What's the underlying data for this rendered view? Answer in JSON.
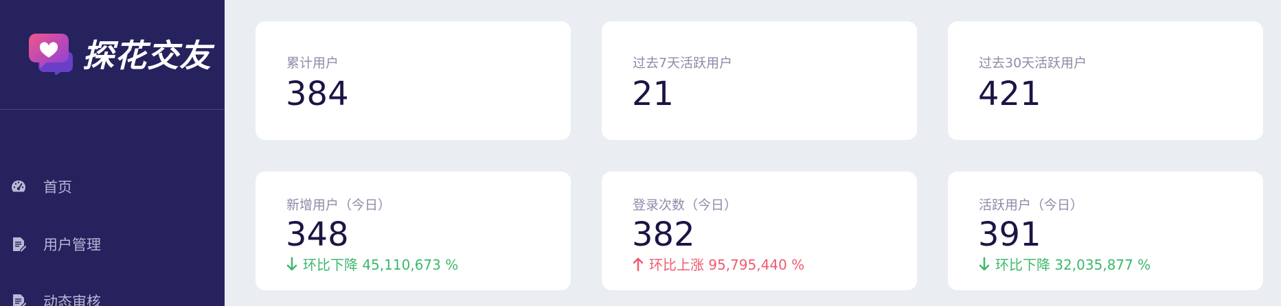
{
  "app": {
    "name": "探花交友"
  },
  "sidebar": {
    "items": [
      {
        "label": "首页",
        "icon": "dashboard-icon"
      },
      {
        "label": "用户管理",
        "icon": "document-icon"
      },
      {
        "label": "动态审核",
        "icon": "document-icon"
      }
    ]
  },
  "stats": {
    "total_users": {
      "label": "累计用户",
      "value": "384"
    },
    "active_7d": {
      "label": "过去7天活跃用户",
      "value": "21"
    },
    "active_30d": {
      "label": "过去30天活跃用户",
      "value": "421"
    },
    "new_today": {
      "label": "新增用户（今日）",
      "value": "348",
      "trend": {
        "direction": "down",
        "text": "环比下降 45,110,673 %",
        "color": "#3bb86b"
      }
    },
    "logins_today": {
      "label": "登录次数（今日）",
      "value": "382",
      "trend": {
        "direction": "up",
        "text": "环比上涨 95,795,440 %",
        "color": "#f05a6e"
      }
    },
    "active_today": {
      "label": "活跃用户（今日）",
      "value": "391",
      "trend": {
        "direction": "down",
        "text": "环比下降 32,035,877 %",
        "color": "#3bb86b"
      }
    }
  },
  "colors": {
    "sidebar_bg": "#25225e",
    "page_bg": "#eaedf1",
    "value_text": "#1b1546"
  }
}
